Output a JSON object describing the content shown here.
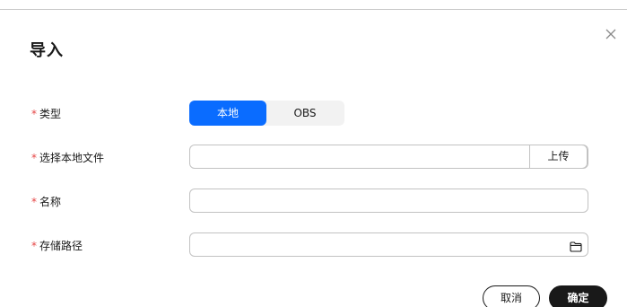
{
  "dialog": {
    "title": "导入"
  },
  "form": {
    "required_mark": "*",
    "type": {
      "label": "类型",
      "options": [
        "本地",
        "OBS"
      ],
      "selected": "本地"
    },
    "local_file": {
      "label": "选择本地文件",
      "value": "",
      "upload_label": "上传"
    },
    "name": {
      "label": "名称",
      "value": ""
    },
    "storage_path": {
      "label": "存储路径",
      "value": ""
    }
  },
  "footer": {
    "cancel_label": "取消",
    "confirm_label": "确定"
  },
  "colors": {
    "accent": "#0a6cff",
    "required": "#e54545",
    "primary_button": "#191919"
  },
  "icons": {
    "close": "close-icon",
    "folder": "folder-icon"
  }
}
